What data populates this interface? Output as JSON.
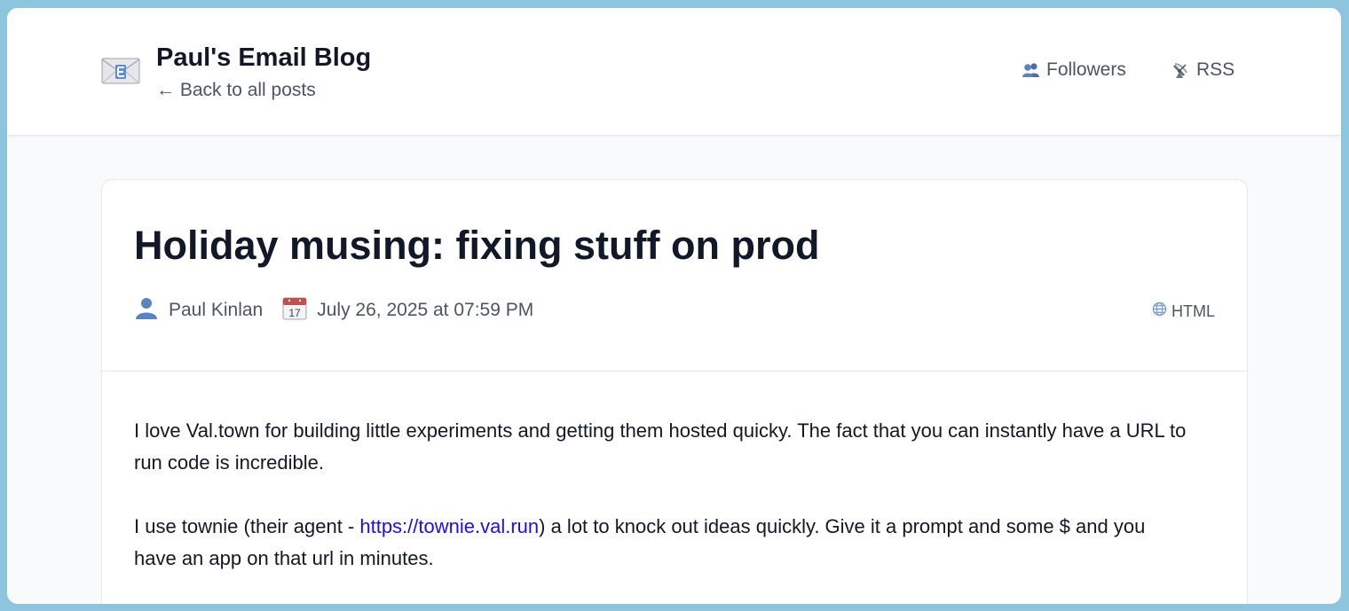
{
  "header": {
    "logo_icon": "envelope-e-icon",
    "blog_title": "Paul's Email Blog",
    "back_link": "← Back to all posts",
    "nav": {
      "followers_icon": "people-icon",
      "followers_label": "Followers",
      "rss_icon": "satellite-antenna-icon",
      "rss_label": "RSS"
    }
  },
  "post": {
    "title": "Holiday musing: fixing stuff on prod",
    "author_icon": "person-icon",
    "author": "Paul Kinlan",
    "date_icon": "calendar-icon",
    "calendar_day": "17",
    "date": "July 26, 2025 at 07:59 PM",
    "format_icon": "globe-icon",
    "format": "HTML",
    "paragraph1": "I love Val.town for building little experiments and getting them hosted quicky. The fact that you can instantly have a URL to run code is incredible.",
    "paragraph2_before": "I use townie (their agent - ",
    "paragraph2_link": "https://townie.val.run",
    "paragraph2_after": ") a lot to knock out ideas quickly. Give it a prompt and some $ and you have an app on that url in minutes."
  },
  "colors": {
    "page_background": "#8cc5dd",
    "link": "#1a0dff",
    "muted_text": "#4b5563",
    "heading": "#111827"
  }
}
